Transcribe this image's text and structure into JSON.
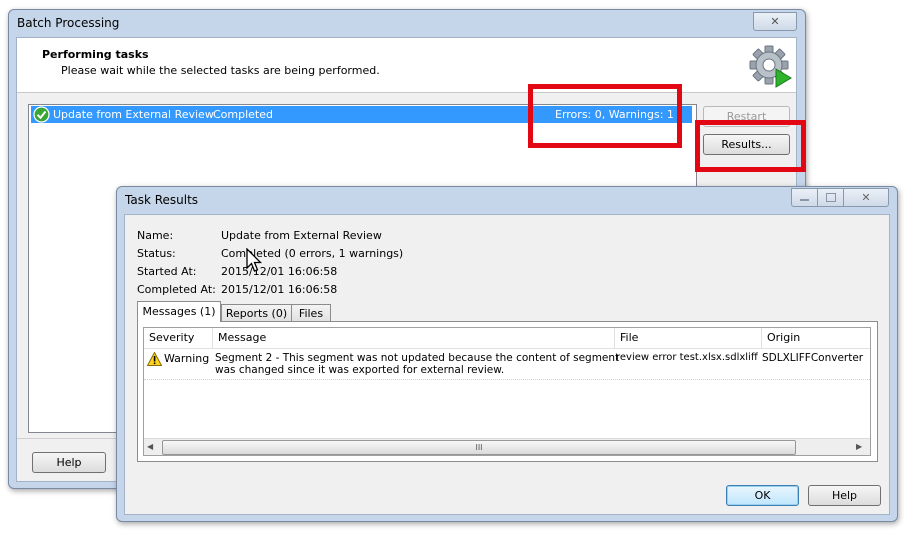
{
  "batch": {
    "title": "Batch Processing",
    "close_glyph": "✕",
    "header_title": "Performing tasks",
    "header_desc": "Please wait while the selected tasks are being performed.",
    "task_name": "Update from External Review",
    "task_status": "Completed",
    "task_summary": "Errors: 0, Warnings: 1",
    "restart_label": "Restart",
    "results_label": "Results...",
    "help_label": "Help"
  },
  "task_results": {
    "title": "Task Results",
    "fields": [
      {
        "label": "Name:",
        "value": "Update from External Review"
      },
      {
        "label": "Status:",
        "value": "Completed (0 errors, 1 warnings)"
      },
      {
        "label": "Started At:",
        "value": "2015/12/01 16:06:58"
      },
      {
        "label": "Completed At:",
        "value": "2015/12/01 16:06:58"
      }
    ],
    "tabs": [
      {
        "label": "Messages (1)",
        "active": true
      },
      {
        "label": "Reports (0)",
        "active": false
      },
      {
        "label": "Files",
        "active": false
      }
    ],
    "columns": [
      "Severity",
      "Message",
      "File",
      "Origin"
    ],
    "rows": [
      {
        "severity": "Warning",
        "message_line1": "Segment 2 - This segment was not updated because the content of segment",
        "message_line2": "was changed since it was exported for external review.",
        "file": "review error test.xlsx.sdlxliff",
        "origin": "SDLXLIFFConverter"
      }
    ],
    "scroll_grip": "III",
    "ok_label": "OK",
    "help_label": "Help"
  },
  "colors": {
    "highlight": "#e30613",
    "selection": "#3399ff",
    "frame": "#c5d6ea"
  },
  "icons": [
    "check-circle-icon",
    "gear-play-icon",
    "warning-icon",
    "mouse-cursor-icon",
    "minimize-icon",
    "maximize-icon",
    "close-icon"
  ]
}
